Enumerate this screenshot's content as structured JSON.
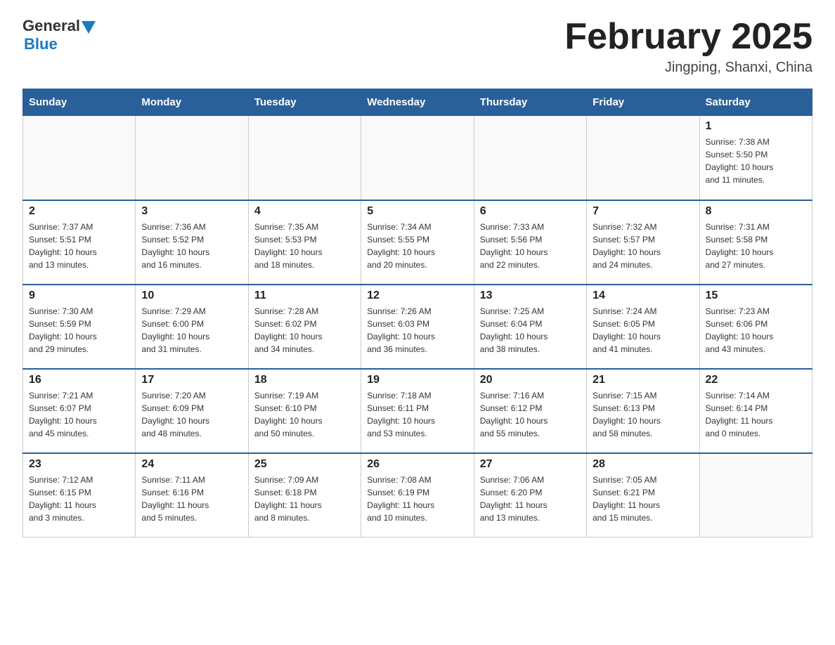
{
  "header": {
    "logo_general": "General",
    "logo_blue": "Blue",
    "month_title": "February 2025",
    "location": "Jingping, Shanxi, China"
  },
  "weekdays": [
    "Sunday",
    "Monday",
    "Tuesday",
    "Wednesday",
    "Thursday",
    "Friday",
    "Saturday"
  ],
  "weeks": [
    [
      {
        "day": "",
        "info": ""
      },
      {
        "day": "",
        "info": ""
      },
      {
        "day": "",
        "info": ""
      },
      {
        "day": "",
        "info": ""
      },
      {
        "day": "",
        "info": ""
      },
      {
        "day": "",
        "info": ""
      },
      {
        "day": "1",
        "info": "Sunrise: 7:38 AM\nSunset: 5:50 PM\nDaylight: 10 hours\nand 11 minutes."
      }
    ],
    [
      {
        "day": "2",
        "info": "Sunrise: 7:37 AM\nSunset: 5:51 PM\nDaylight: 10 hours\nand 13 minutes."
      },
      {
        "day": "3",
        "info": "Sunrise: 7:36 AM\nSunset: 5:52 PM\nDaylight: 10 hours\nand 16 minutes."
      },
      {
        "day": "4",
        "info": "Sunrise: 7:35 AM\nSunset: 5:53 PM\nDaylight: 10 hours\nand 18 minutes."
      },
      {
        "day": "5",
        "info": "Sunrise: 7:34 AM\nSunset: 5:55 PM\nDaylight: 10 hours\nand 20 minutes."
      },
      {
        "day": "6",
        "info": "Sunrise: 7:33 AM\nSunset: 5:56 PM\nDaylight: 10 hours\nand 22 minutes."
      },
      {
        "day": "7",
        "info": "Sunrise: 7:32 AM\nSunset: 5:57 PM\nDaylight: 10 hours\nand 24 minutes."
      },
      {
        "day": "8",
        "info": "Sunrise: 7:31 AM\nSunset: 5:58 PM\nDaylight: 10 hours\nand 27 minutes."
      }
    ],
    [
      {
        "day": "9",
        "info": "Sunrise: 7:30 AM\nSunset: 5:59 PM\nDaylight: 10 hours\nand 29 minutes."
      },
      {
        "day": "10",
        "info": "Sunrise: 7:29 AM\nSunset: 6:00 PM\nDaylight: 10 hours\nand 31 minutes."
      },
      {
        "day": "11",
        "info": "Sunrise: 7:28 AM\nSunset: 6:02 PM\nDaylight: 10 hours\nand 34 minutes."
      },
      {
        "day": "12",
        "info": "Sunrise: 7:26 AM\nSunset: 6:03 PM\nDaylight: 10 hours\nand 36 minutes."
      },
      {
        "day": "13",
        "info": "Sunrise: 7:25 AM\nSunset: 6:04 PM\nDaylight: 10 hours\nand 38 minutes."
      },
      {
        "day": "14",
        "info": "Sunrise: 7:24 AM\nSunset: 6:05 PM\nDaylight: 10 hours\nand 41 minutes."
      },
      {
        "day": "15",
        "info": "Sunrise: 7:23 AM\nSunset: 6:06 PM\nDaylight: 10 hours\nand 43 minutes."
      }
    ],
    [
      {
        "day": "16",
        "info": "Sunrise: 7:21 AM\nSunset: 6:07 PM\nDaylight: 10 hours\nand 45 minutes."
      },
      {
        "day": "17",
        "info": "Sunrise: 7:20 AM\nSunset: 6:09 PM\nDaylight: 10 hours\nand 48 minutes."
      },
      {
        "day": "18",
        "info": "Sunrise: 7:19 AM\nSunset: 6:10 PM\nDaylight: 10 hours\nand 50 minutes."
      },
      {
        "day": "19",
        "info": "Sunrise: 7:18 AM\nSunset: 6:11 PM\nDaylight: 10 hours\nand 53 minutes."
      },
      {
        "day": "20",
        "info": "Sunrise: 7:16 AM\nSunset: 6:12 PM\nDaylight: 10 hours\nand 55 minutes."
      },
      {
        "day": "21",
        "info": "Sunrise: 7:15 AM\nSunset: 6:13 PM\nDaylight: 10 hours\nand 58 minutes."
      },
      {
        "day": "22",
        "info": "Sunrise: 7:14 AM\nSunset: 6:14 PM\nDaylight: 11 hours\nand 0 minutes."
      }
    ],
    [
      {
        "day": "23",
        "info": "Sunrise: 7:12 AM\nSunset: 6:15 PM\nDaylight: 11 hours\nand 3 minutes."
      },
      {
        "day": "24",
        "info": "Sunrise: 7:11 AM\nSunset: 6:16 PM\nDaylight: 11 hours\nand 5 minutes."
      },
      {
        "day": "25",
        "info": "Sunrise: 7:09 AM\nSunset: 6:18 PM\nDaylight: 11 hours\nand 8 minutes."
      },
      {
        "day": "26",
        "info": "Sunrise: 7:08 AM\nSunset: 6:19 PM\nDaylight: 11 hours\nand 10 minutes."
      },
      {
        "day": "27",
        "info": "Sunrise: 7:06 AM\nSunset: 6:20 PM\nDaylight: 11 hours\nand 13 minutes."
      },
      {
        "day": "28",
        "info": "Sunrise: 7:05 AM\nSunset: 6:21 PM\nDaylight: 11 hours\nand 15 minutes."
      },
      {
        "day": "",
        "info": ""
      }
    ]
  ]
}
